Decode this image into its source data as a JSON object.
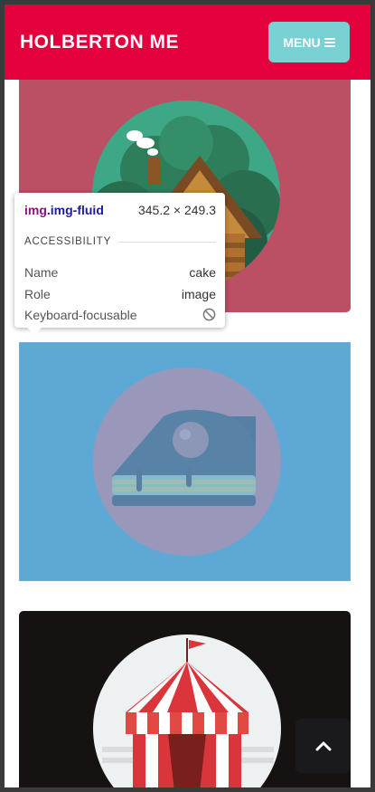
{
  "navbar": {
    "brand": "HOLBERTON ME",
    "menu_label": "MENU",
    "background": "#e4003d",
    "menu_background": "#79d1d4"
  },
  "portfolio": {
    "items": [
      {
        "icon": "cabin-icon",
        "background": "#bb5065"
      },
      {
        "icon": "cake-icon",
        "background": "#55a8d3"
      },
      {
        "icon": "circus-tent-icon",
        "background": "#161212"
      }
    ]
  },
  "inspector": {
    "element": "img",
    "class": ".img-fluid",
    "size": "345.2 × 249.3",
    "section": "ACCESSIBILITY",
    "rows": [
      {
        "label": "Name",
        "value": "cake"
      },
      {
        "label": "Role",
        "value": "image"
      },
      {
        "label": "Keyboard-focusable",
        "value": "",
        "icon": "not-allowed-icon"
      }
    ]
  },
  "scroll_top": {
    "icon": "chevron-up-icon"
  }
}
